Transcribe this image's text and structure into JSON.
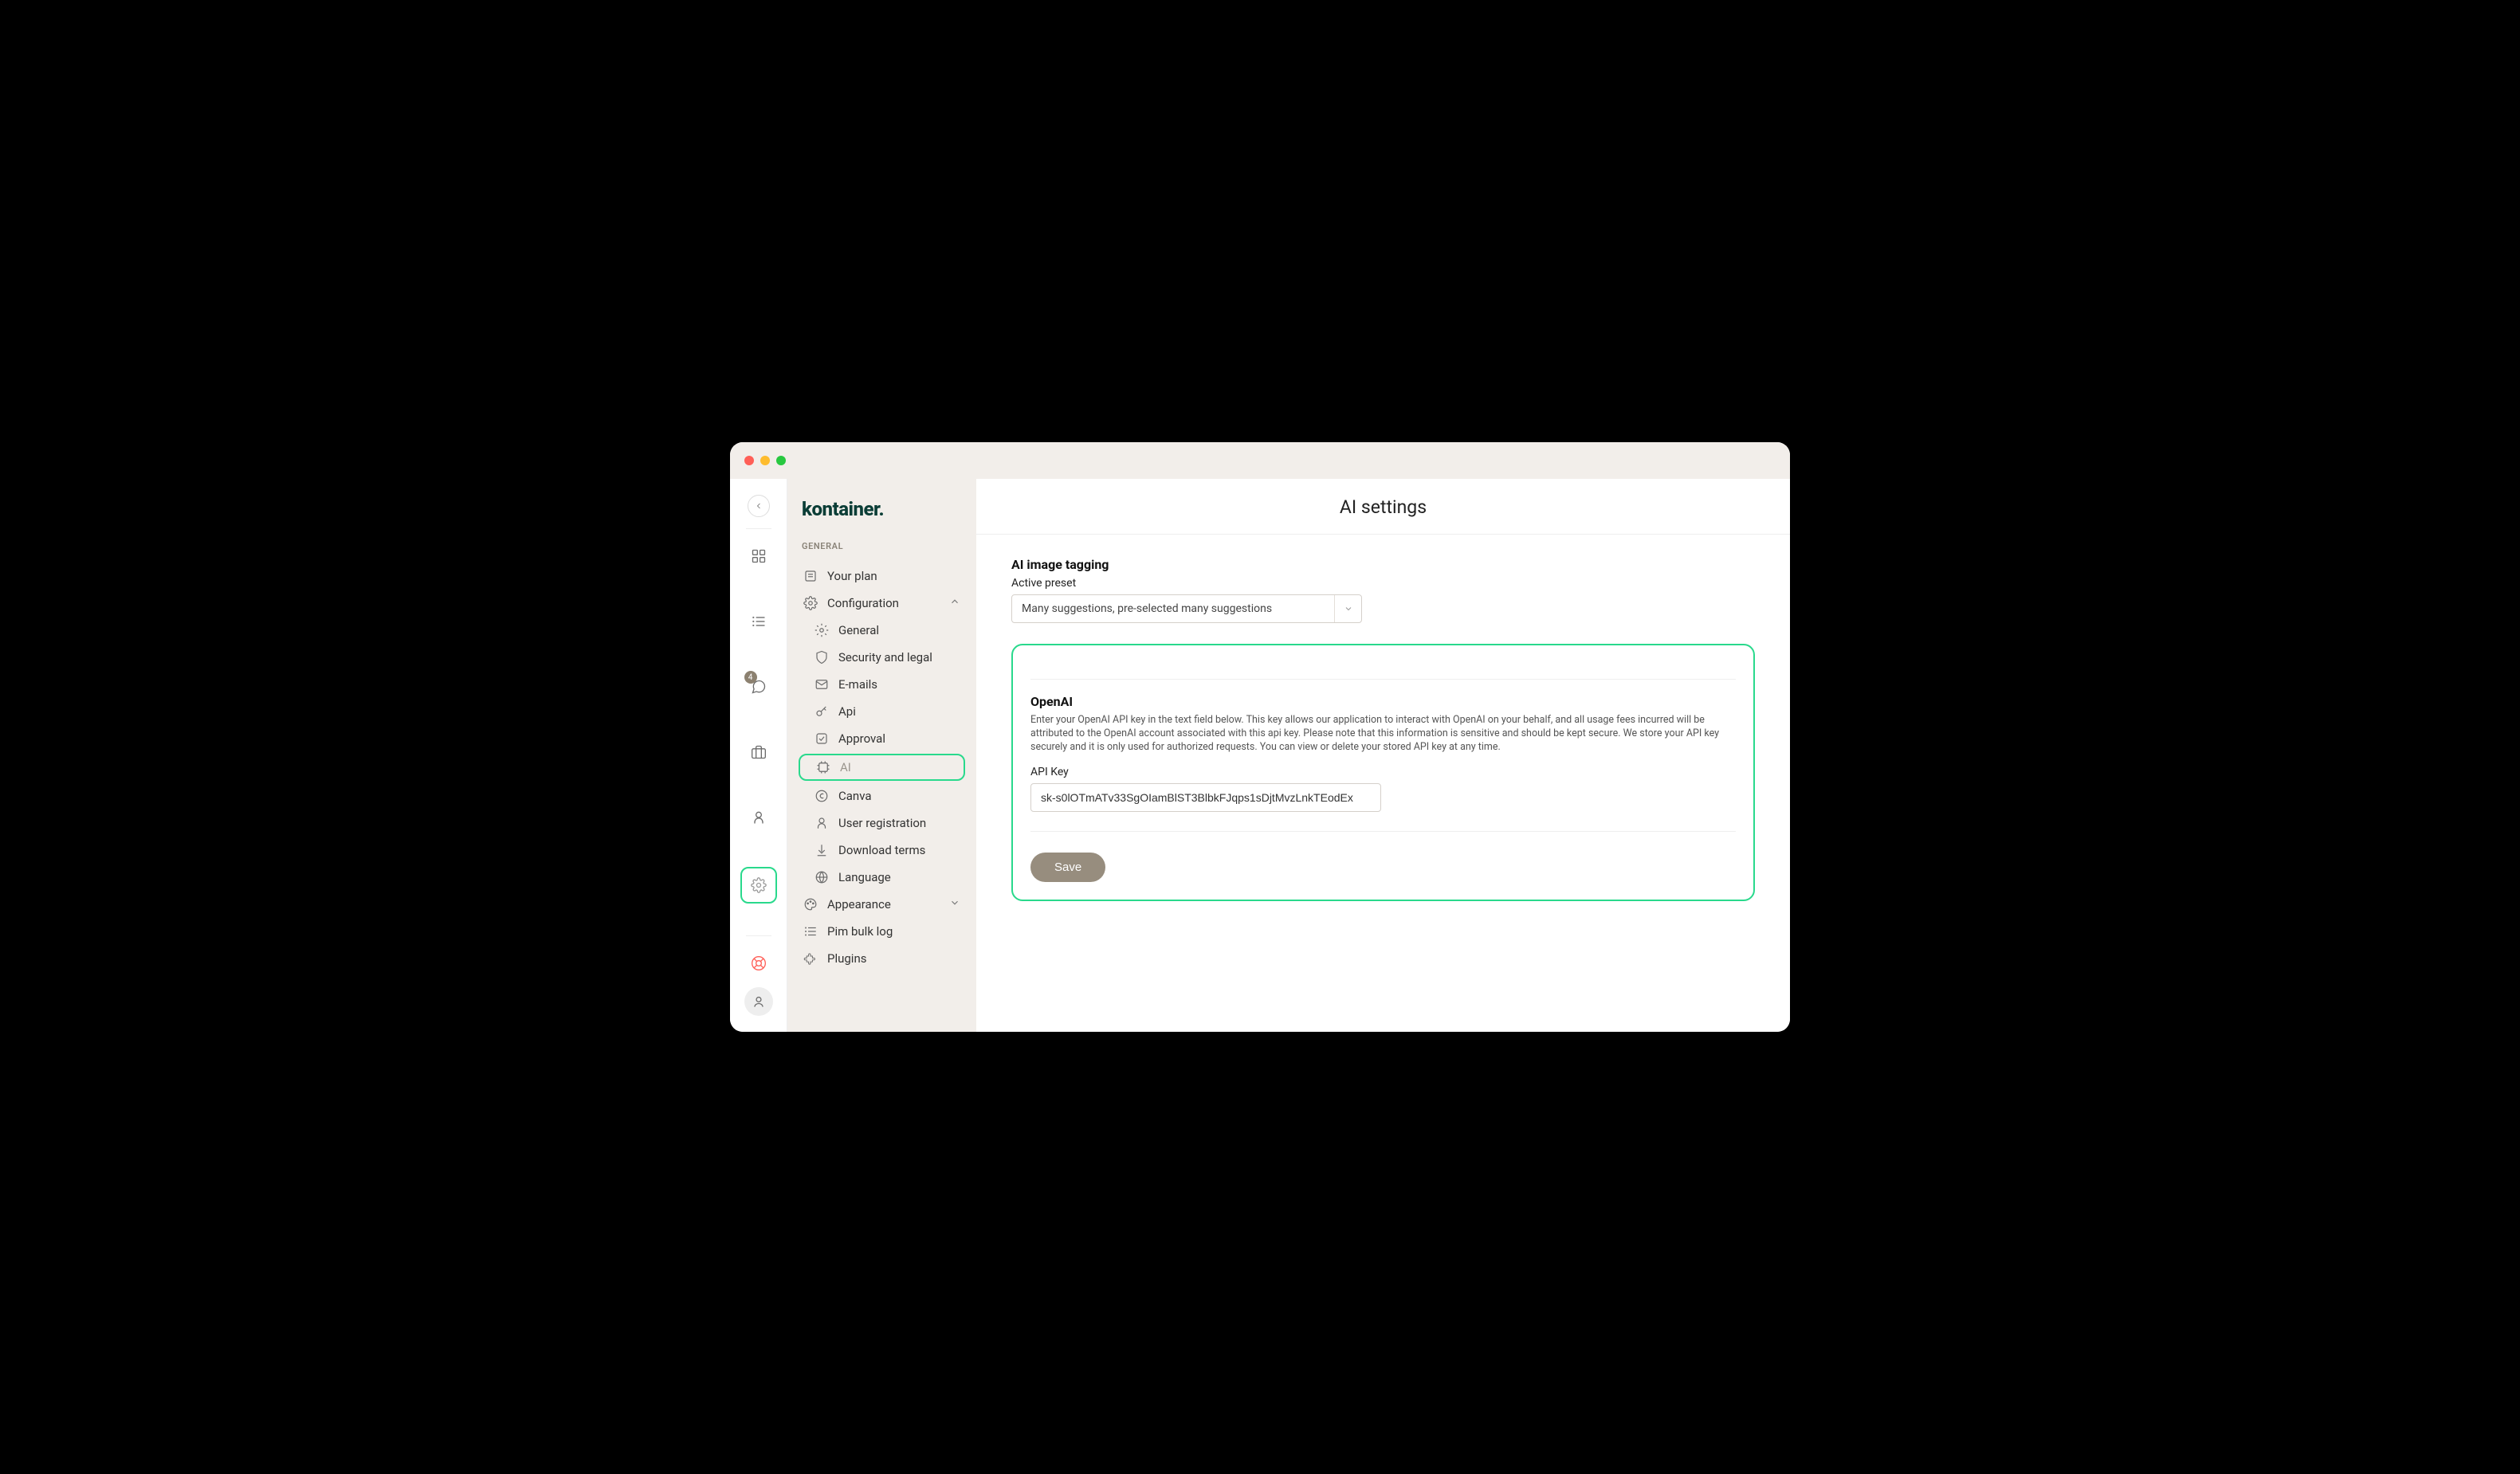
{
  "brand": "kontainer.",
  "rail": {
    "notification_badge": "4"
  },
  "sidebar": {
    "section_label": "GENERAL",
    "items": {
      "your_plan": "Your plan",
      "configuration": "Configuration",
      "appearance": "Appearance",
      "pim_bulk_log": "Pim bulk log",
      "plugins": "Plugins"
    },
    "config_sub": {
      "general": "General",
      "security": "Security and legal",
      "emails": "E-mails",
      "api": "Api",
      "approval": "Approval",
      "ai": "AI",
      "canva": "Canva",
      "user_registration": "User registration",
      "download_terms": "Download terms",
      "language": "Language"
    }
  },
  "main": {
    "title": "AI settings",
    "tagging": {
      "heading": "AI image tagging",
      "preset_label": "Active preset",
      "preset_value": "Many suggestions, pre-selected many suggestions"
    },
    "openai": {
      "heading": "OpenAI",
      "description": "Enter your OpenAI API key in the text field below. This key allows our application to interact with OpenAI on your behalf, and all usage fees incurred will be attributed to the OpenAI account associated with this api key. Please note that this information is sensitive and should be kept secure. We store your API key securely and it is only used for authorized requests. You can view or delete your stored API key at any time.",
      "api_key_label": "API Key",
      "api_key_value": "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",
      "save_label": "Save"
    }
  }
}
